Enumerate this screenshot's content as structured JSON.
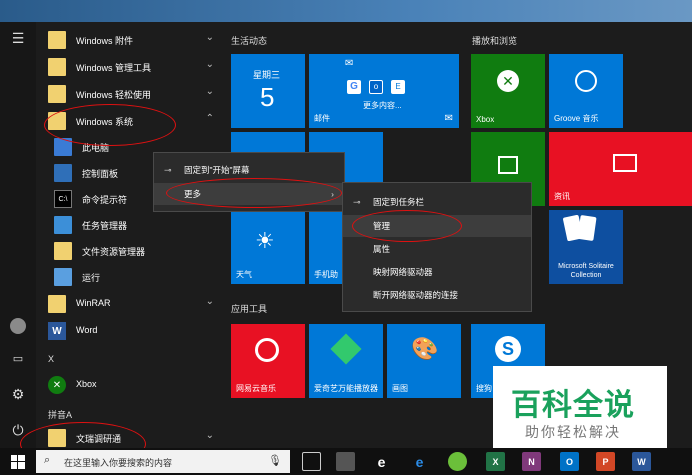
{
  "sections": {
    "life": "生活动态",
    "play": "播放和浏览",
    "tools": "应用工具"
  },
  "apps": [
    {
      "label": "Windows 附件",
      "chevron": "⌄"
    },
    {
      "label": "Windows 管理工具",
      "chevron": "⌄"
    },
    {
      "label": "Windows 轻松使用",
      "chevron": "⌄"
    },
    {
      "label": "Windows 系统",
      "chevron": "⌃"
    },
    {
      "label": "此电脑"
    },
    {
      "label": "控制面板"
    },
    {
      "label": "命令提示符"
    },
    {
      "label": "任务管理器"
    },
    {
      "label": "文件资源管理器"
    },
    {
      "label": "运行"
    },
    {
      "label": "WinRAR",
      "chevron": "⌄"
    },
    {
      "label": "Word"
    },
    {
      "label": "Xbox"
    },
    {
      "label": "文瑞调研通",
      "chevron": "⌄"
    }
  ],
  "letters": {
    "x": "X",
    "pinyin_a": "拼音A"
  },
  "tiles": {
    "calendar": {
      "weekday": "星期三",
      "day": "5"
    },
    "mail": {
      "more": "更多内容...",
      "label": "邮件"
    },
    "xbox": "Xbox",
    "groove": "Groove 音乐",
    "news": "资讯",
    "solitaire": "Microsoft Solitaire Collection",
    "weather": "天气",
    "phone": "手机助",
    "netease": "网易云音乐",
    "iqiyi": "爱奇艺万能播放器",
    "paint": "画图",
    "search": "搜狗"
  },
  "context_menu_1": {
    "pin_start": "固定到\"开始\"屏幕",
    "more": "更多"
  },
  "context_menu_2": {
    "pin_taskbar": "固定到任务栏",
    "manage": "管理",
    "properties": "属性",
    "map_drive": "映射网络驱动器",
    "disconnect_drive": "断开网络驱动器的连接"
  },
  "taskbar": {
    "search_placeholder": "在这里输入你要搜索的内容"
  },
  "watermark": {
    "title": "百科全说",
    "subtitle": "助你轻松解决"
  },
  "colors": {
    "tile_blue": "#0078d7",
    "tile_green": "#107c10",
    "tile_red": "#e81123",
    "folder": "#f1d170"
  }
}
